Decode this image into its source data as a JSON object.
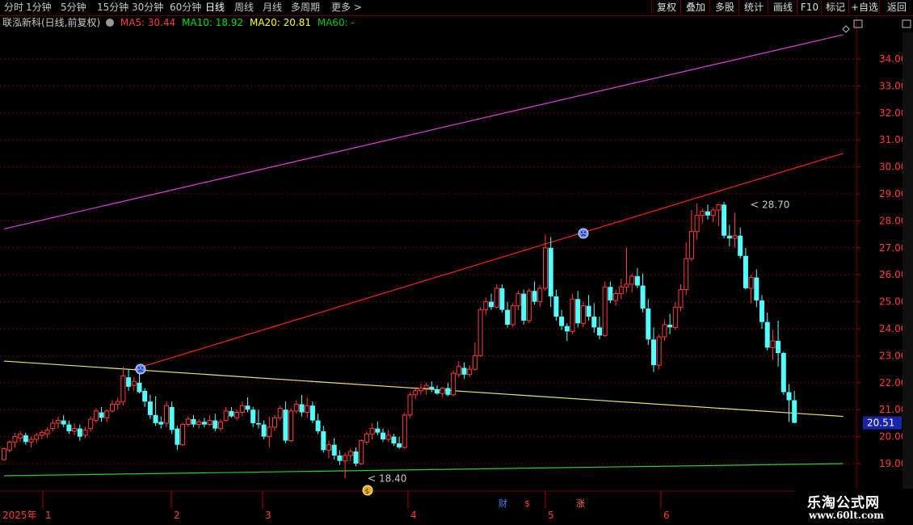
{
  "toolbar": {
    "periods": [
      "分时",
      "1分钟",
      "5分钟",
      "15分钟",
      "30分钟",
      "60分钟",
      "日线",
      "周线",
      "月线",
      "多周期",
      "更多 >"
    ],
    "active_period": "日线",
    "right_buttons": [
      "复权",
      "叠加",
      "多股",
      "统计",
      "画线",
      "F10",
      "标记",
      "+自选",
      "返回"
    ]
  },
  "info": {
    "stock_name": "联泓新科(日线,前复权)",
    "ma5_label": "MA5: 30.44",
    "ma10_label": "MA10: 18.92",
    "ma20_label": "MA20: 20.81",
    "ma60_label": "MA60: -",
    "colors": {
      "name": "#c8c8c8",
      "ma5": "#ff3c3c",
      "ma10": "#00e000",
      "ma20": "#ffff00",
      "ma60": "#00c800"
    }
  },
  "price_axis": {
    "ticks": [
      "19.00",
      "20.00",
      "21.00",
      "22.00",
      "23.00",
      "24.00",
      "25.00",
      "26.00",
      "27.00",
      "28.00",
      "29.00",
      "30.00",
      "31.00",
      "32.00",
      "33.00",
      "34.00"
    ],
    "current_price": "20.51"
  },
  "time_axis": {
    "year_label": "2025年",
    "months": [
      "1",
      "2",
      "3",
      "4",
      "5",
      "6"
    ]
  },
  "annotations": {
    "high_label": "28.70",
    "low_label": "18.40",
    "event_icons": [
      "财",
      "$",
      "涨"
    ]
  },
  "colors": {
    "up": "#ff3c3c",
    "down": "#54ffff",
    "grid": "#7a0000",
    "trend_purple": "#e040e0",
    "trend_red": "#ff2020",
    "trend_yellow": "#e8e870",
    "trend_green": "#30d030"
  },
  "chart_data": {
    "type": "candlestick",
    "description_free": true,
    "price_range": [
      18.6,
      34.4
    ],
    "candles": [
      [
        19.15,
        19.6,
        19.1,
        19.55
      ],
      [
        19.5,
        19.85,
        19.4,
        19.8
      ],
      [
        19.8,
        20.15,
        19.6,
        20.0
      ],
      [
        19.95,
        20.2,
        19.8,
        20.1
      ],
      [
        20.05,
        20.15,
        19.7,
        19.8
      ],
      [
        19.8,
        20.0,
        19.6,
        19.9
      ],
      [
        19.9,
        20.15,
        19.75,
        20.05
      ],
      [
        20.05,
        20.25,
        19.9,
        20.15
      ],
      [
        20.1,
        20.35,
        19.95,
        20.25
      ],
      [
        20.3,
        20.65,
        20.2,
        20.5
      ],
      [
        20.5,
        20.75,
        20.3,
        20.6
      ],
      [
        20.6,
        20.8,
        20.35,
        20.45
      ],
      [
        20.45,
        20.6,
        20.1,
        20.2
      ],
      [
        20.2,
        20.5,
        20.05,
        20.3
      ],
      [
        20.3,
        20.45,
        19.85,
        20.0
      ],
      [
        20.05,
        20.35,
        19.95,
        20.25
      ],
      [
        20.3,
        20.75,
        20.2,
        20.65
      ],
      [
        20.6,
        21.05,
        20.5,
        20.95
      ],
      [
        20.9,
        21.1,
        20.55,
        20.7
      ],
      [
        20.7,
        21.0,
        20.55,
        20.95
      ],
      [
        20.95,
        21.35,
        20.9,
        21.2
      ],
      [
        21.2,
        21.45,
        21.0,
        21.3
      ],
      [
        21.3,
        22.6,
        21.15,
        22.25
      ],
      [
        22.2,
        22.5,
        21.7,
        21.85
      ],
      [
        21.9,
        22.2,
        21.7,
        22.05
      ],
      [
        22.0,
        22.35,
        21.6,
        21.65
      ],
      [
        21.7,
        21.8,
        21.1,
        21.3
      ],
      [
        21.3,
        21.55,
        20.65,
        20.8
      ],
      [
        20.8,
        21.5,
        20.4,
        20.5
      ],
      [
        20.55,
        20.75,
        20.3,
        20.45
      ],
      [
        20.5,
        21.3,
        20.35,
        21.15
      ],
      [
        21.1,
        21.3,
        20.1,
        20.25
      ],
      [
        20.3,
        20.4,
        19.5,
        19.7
      ],
      [
        19.7,
        20.5,
        19.65,
        20.45
      ],
      [
        20.45,
        20.75,
        20.35,
        20.65
      ],
      [
        20.65,
        20.8,
        20.35,
        20.45
      ],
      [
        20.45,
        20.65,
        20.3,
        20.55
      ],
      [
        20.55,
        20.7,
        20.35,
        20.45
      ],
      [
        20.45,
        20.8,
        20.4,
        20.6
      ],
      [
        20.6,
        20.85,
        20.2,
        20.3
      ],
      [
        20.3,
        20.65,
        20.2,
        20.55
      ],
      [
        20.6,
        21.1,
        20.55,
        20.95
      ],
      [
        20.95,
        21.1,
        20.7,
        20.75
      ],
      [
        20.7,
        21.0,
        20.6,
        20.9
      ],
      [
        20.9,
        21.3,
        20.75,
        21.15
      ],
      [
        21.15,
        21.45,
        20.9,
        21.0
      ],
      [
        21.0,
        21.1,
        20.35,
        20.5
      ],
      [
        20.5,
        21.0,
        20.3,
        20.45
      ],
      [
        20.45,
        20.6,
        19.9,
        20.0
      ],
      [
        20.0,
        20.75,
        19.6,
        20.35
      ],
      [
        20.35,
        20.8,
        20.2,
        20.7
      ],
      [
        20.7,
        21.15,
        20.6,
        21.05
      ],
      [
        21.0,
        21.3,
        19.75,
        19.85
      ],
      [
        19.85,
        21.05,
        19.8,
        20.95
      ],
      [
        20.95,
        21.35,
        20.85,
        21.2
      ],
      [
        21.2,
        21.55,
        20.75,
        20.9
      ],
      [
        20.9,
        21.45,
        20.7,
        21.15
      ],
      [
        21.15,
        21.3,
        20.5,
        20.6
      ],
      [
        20.6,
        20.85,
        20.1,
        20.2
      ],
      [
        20.2,
        20.4,
        19.4,
        19.5
      ],
      [
        19.5,
        19.85,
        19.2,
        19.7
      ],
      [
        19.7,
        19.95,
        19.15,
        19.3
      ],
      [
        19.3,
        19.5,
        18.95,
        19.1
      ],
      [
        19.1,
        19.4,
        18.45,
        19.3
      ],
      [
        19.3,
        19.55,
        19.1,
        19.45
      ],
      [
        19.45,
        19.6,
        18.9,
        19.0
      ],
      [
        19.0,
        19.9,
        18.95,
        19.85
      ],
      [
        19.8,
        20.2,
        19.7,
        20.1
      ],
      [
        20.1,
        20.5,
        19.9,
        20.3
      ],
      [
        20.3,
        20.55,
        20.05,
        20.15
      ],
      [
        20.15,
        20.3,
        19.8,
        19.9
      ],
      [
        19.9,
        20.25,
        19.8,
        20.05
      ],
      [
        20.0,
        20.1,
        19.65,
        19.75
      ],
      [
        19.75,
        20.0,
        19.55,
        19.6
      ],
      [
        19.6,
        20.9,
        19.55,
        20.8
      ],
      [
        20.8,
        21.65,
        20.7,
        21.55
      ],
      [
        21.55,
        21.85,
        21.4,
        21.7
      ],
      [
        21.7,
        21.95,
        21.55,
        21.8
      ],
      [
        21.8,
        22.0,
        21.55,
        21.9
      ],
      [
        21.85,
        22.05,
        21.65,
        21.75
      ],
      [
        21.75,
        21.9,
        21.55,
        21.6
      ],
      [
        21.6,
        21.85,
        21.45,
        21.8
      ],
      [
        21.8,
        22.0,
        21.5,
        21.55
      ],
      [
        21.55,
        22.45,
        21.5,
        22.35
      ],
      [
        22.3,
        22.8,
        22.2,
        22.6
      ],
      [
        22.55,
        22.75,
        22.15,
        22.3
      ],
      [
        22.3,
        22.65,
        22.2,
        22.5
      ],
      [
        22.5,
        23.5,
        22.45,
        23.0
      ],
      [
        23.0,
        24.8,
        22.95,
        24.7
      ],
      [
        24.7,
        25.15,
        24.5,
        25.0
      ],
      [
        25.0,
        25.3,
        24.7,
        24.8
      ],
      [
        24.8,
        25.65,
        24.75,
        25.5
      ],
      [
        25.5,
        25.65,
        24.6,
        24.7
      ],
      [
        24.7,
        25.0,
        24.05,
        24.15
      ],
      [
        24.15,
        24.95,
        24.05,
        24.85
      ],
      [
        24.85,
        25.4,
        24.7,
        25.3
      ],
      [
        25.3,
        25.45,
        24.15,
        24.3
      ],
      [
        24.3,
        25.5,
        24.2,
        25.4
      ],
      [
        25.4,
        25.75,
        24.9,
        25.0
      ],
      [
        25.0,
        25.6,
        24.8,
        25.5
      ],
      [
        25.5,
        27.5,
        25.4,
        27.0
      ],
      [
        27.0,
        27.4,
        24.8,
        25.2
      ],
      [
        25.2,
        25.45,
        24.3,
        24.45
      ],
      [
        24.45,
        24.7,
        23.95,
        24.1
      ],
      [
        24.1,
        24.2,
        23.55,
        23.9
      ],
      [
        23.9,
        25.3,
        23.8,
        25.1
      ],
      [
        25.1,
        25.4,
        24.05,
        24.2
      ],
      [
        24.2,
        25.0,
        24.05,
        24.85
      ],
      [
        24.85,
        25.25,
        24.3,
        24.45
      ],
      [
        24.45,
        24.95,
        23.85,
        24.05
      ],
      [
        24.05,
        24.45,
        23.6,
        23.75
      ],
      [
        23.75,
        25.75,
        23.7,
        25.55
      ],
      [
        25.55,
        25.75,
        24.95,
        25.05
      ],
      [
        25.05,
        25.45,
        24.85,
        25.3
      ],
      [
        25.3,
        25.85,
        25.1,
        25.55
      ],
      [
        25.55,
        27.0,
        25.35,
        25.65
      ],
      [
        25.65,
        26.05,
        25.35,
        25.95
      ],
      [
        25.95,
        26.25,
        25.5,
        25.6
      ],
      [
        25.6,
        26.05,
        24.6,
        24.75
      ],
      [
        24.75,
        25.1,
        23.4,
        23.6
      ],
      [
        23.6,
        24.05,
        22.4,
        22.65
      ],
      [
        22.65,
        23.8,
        22.5,
        23.7
      ],
      [
        23.7,
        24.35,
        23.55,
        24.15
      ],
      [
        24.15,
        24.55,
        23.8,
        24.05
      ],
      [
        24.05,
        25.0,
        23.95,
        24.8
      ],
      [
        24.8,
        25.65,
        24.65,
        25.45
      ],
      [
        25.45,
        27.2,
        25.25,
        26.6
      ],
      [
        26.6,
        28.4,
        26.5,
        27.6
      ],
      [
        27.6,
        28.65,
        27.3,
        28.2
      ],
      [
        28.2,
        28.45,
        27.9,
        28.35
      ],
      [
        28.35,
        28.6,
        28.05,
        28.2
      ],
      [
        28.2,
        28.5,
        27.95,
        28.4
      ],
      [
        28.4,
        28.55,
        27.8,
        28.6
      ],
      [
        28.6,
        28.7,
        27.35,
        27.45
      ],
      [
        27.45,
        27.85,
        27.05,
        27.35
      ],
      [
        27.35,
        28.3,
        27.0,
        27.45
      ],
      [
        27.45,
        27.75,
        26.6,
        26.7
      ],
      [
        26.7,
        27.0,
        25.45,
        25.5
      ],
      [
        25.5,
        26.0,
        24.95,
        25.9
      ],
      [
        25.9,
        26.2,
        24.8,
        25.05
      ],
      [
        25.05,
        25.25,
        24.0,
        24.25
      ],
      [
        24.25,
        24.6,
        23.2,
        23.3
      ],
      [
        23.3,
        23.95,
        22.85,
        23.55
      ],
      [
        23.55,
        24.3,
        22.6,
        23.1
      ],
      [
        23.1,
        23.15,
        21.55,
        21.65
      ],
      [
        21.65,
        21.95,
        20.55,
        21.35
      ],
      [
        21.35,
        21.7,
        20.5,
        20.51
      ]
    ],
    "trend_lines": [
      {
        "name": "purple",
        "from": [
          0,
          27.7
        ],
        "to": [
          155,
          34.9
        ]
      },
      {
        "name": "red",
        "from": [
          24,
          22.5
        ],
        "to": [
          155,
          30.5
        ]
      },
      {
        "name": "yellow",
        "from": [
          0,
          22.8
        ],
        "to": [
          155,
          20.75
        ]
      },
      {
        "name": "green",
        "from": [
          0,
          18.55
        ],
        "to": [
          155,
          19.0
        ]
      }
    ]
  }
}
